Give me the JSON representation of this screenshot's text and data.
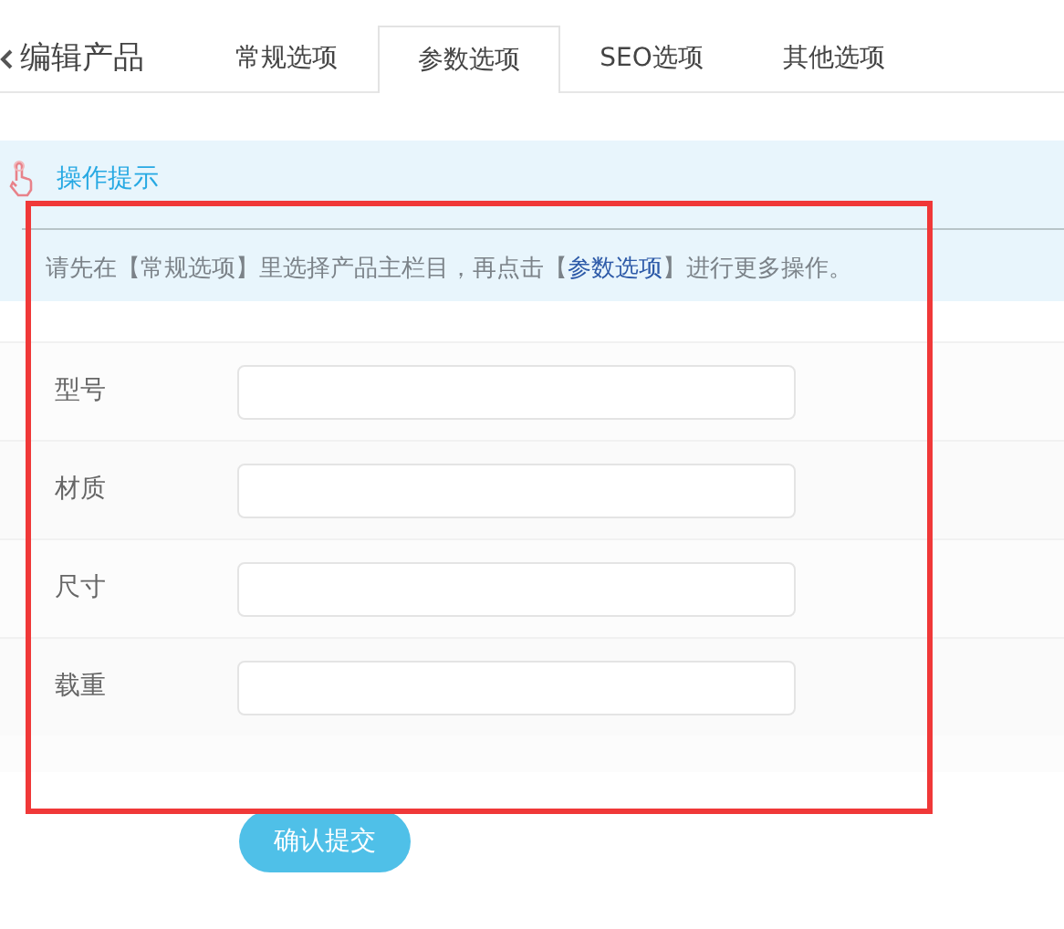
{
  "header": {
    "title": "编辑产品"
  },
  "tabs": [
    {
      "label": "常规选项",
      "selected": false
    },
    {
      "label": "参数选项",
      "selected": true
    },
    {
      "label": "SEO选项",
      "selected": false
    },
    {
      "label": "其他选项",
      "selected": false
    }
  ],
  "tip": {
    "title": "操作提示",
    "segments": [
      {
        "kind": "plain",
        "text": "请先在【常规选项】里选择产品主栏目，再点击【"
      },
      {
        "kind": "link",
        "text": "参数选项"
      },
      {
        "kind": "plain",
        "text": "】进行更多操作。"
      }
    ]
  },
  "fields": [
    {
      "label": "型号"
    },
    {
      "label": "材质"
    },
    {
      "label": "尺寸"
    },
    {
      "label": "载重"
    }
  ],
  "submit": "确认提交"
}
